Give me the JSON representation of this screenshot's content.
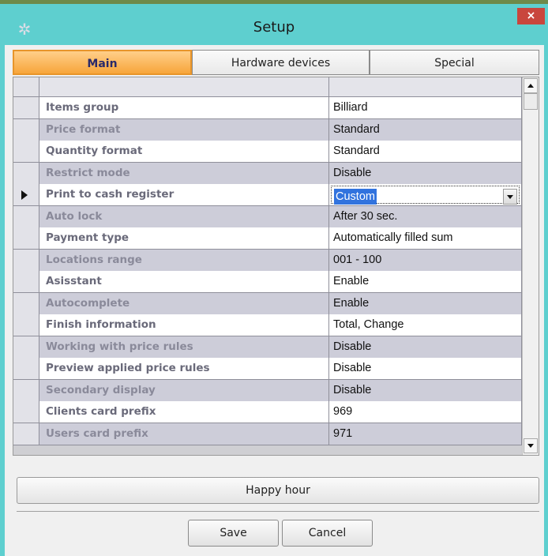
{
  "window": {
    "title": "Setup",
    "close": "×",
    "icon": "gear-icon"
  },
  "tabs": [
    {
      "label": "Main",
      "active": true
    },
    {
      "label": "Hardware devices",
      "active": false
    },
    {
      "label": "Special",
      "active": false
    }
  ],
  "grid": {
    "rows": [
      {
        "name": "Items group",
        "value": "Billiard"
      },
      {
        "name": "Price format",
        "value": "Standard"
      },
      {
        "name": "Quantity format",
        "value": "Standard"
      },
      {
        "name": "Restrict mode",
        "value": "Disable"
      },
      {
        "name": "Print to cash register",
        "value": "Custom"
      },
      {
        "name": "Auto lock",
        "value": "After 30 sec."
      },
      {
        "name": "Payment type",
        "value": "Automatically filled sum"
      },
      {
        "name": "Locations range",
        "value": "001 - 100"
      },
      {
        "name": "Asisstant",
        "value": "Enable"
      },
      {
        "name": "Autocomplete",
        "value": "Enable"
      },
      {
        "name": "Finish information",
        "value": "Total, Change"
      },
      {
        "name": "Working with price rules",
        "value": "Disable"
      },
      {
        "name": "Preview applied price rules",
        "value": "Disable"
      },
      {
        "name": "Secondary display",
        "value": "Disable"
      },
      {
        "name": "Clients card prefix",
        "value": "969"
      },
      {
        "name": "Users card prefix",
        "value": "971"
      }
    ]
  },
  "buttons": {
    "happy_hour": "Happy hour",
    "save": "Save",
    "cancel": "Cancel"
  },
  "colors": {
    "accent_tab": "#f7a53a",
    "frame": "#5ecfcf",
    "selection": "#3173de",
    "close": "#c9463d"
  }
}
